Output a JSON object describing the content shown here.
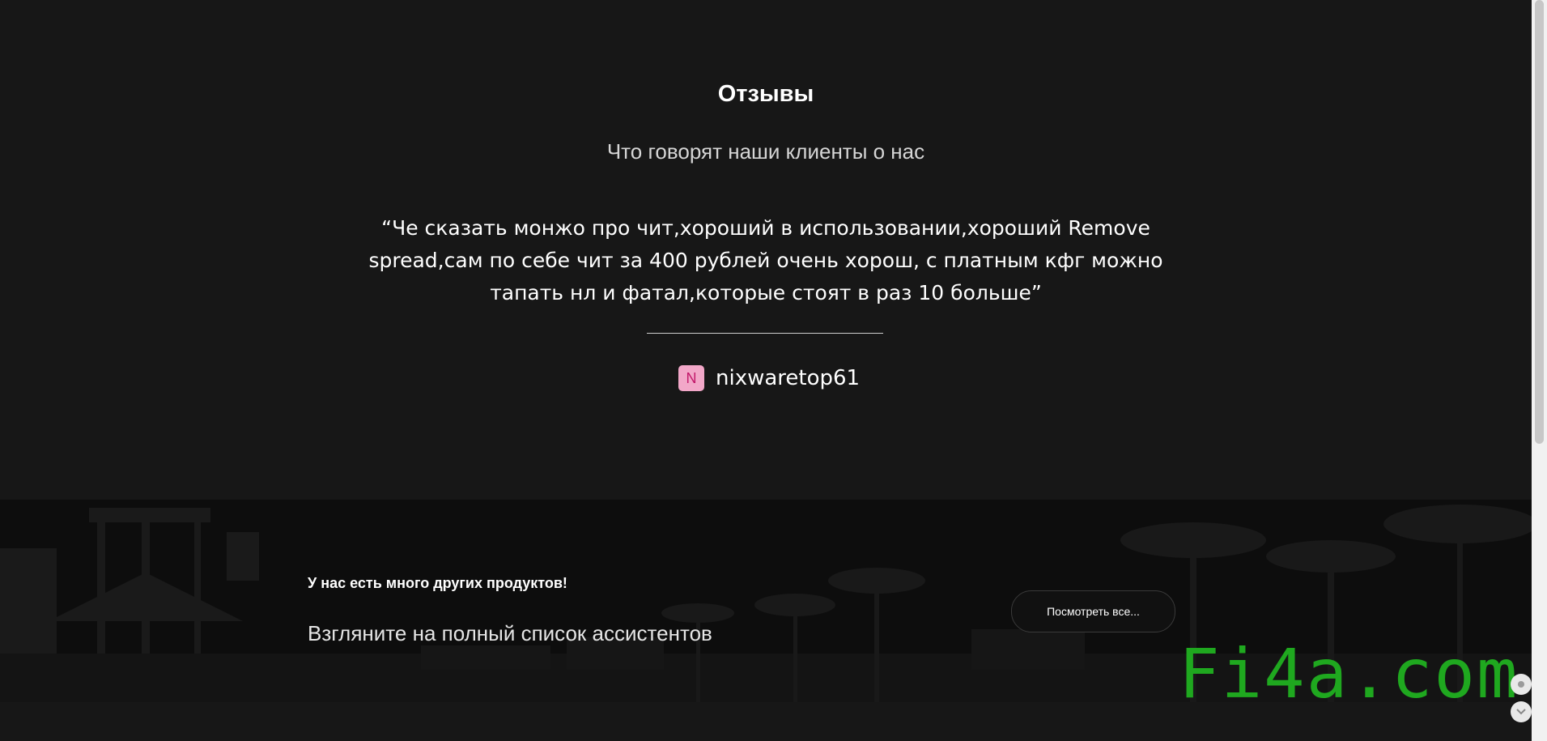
{
  "reviews": {
    "title": "Отзывы",
    "subtitle": "Что говорят наши клиенты о нас",
    "quote": "“Че сказать монжо про чит,хороший в использовании,хороший Remove spread,сам по себе чит за 400 рублей очень хорош, с платным кфг можно тапать нл и фатал,которые стоят в раз 10 больше”",
    "author": {
      "avatar_letter": "N",
      "name": "nixwaretop61",
      "avatar_color": "#f2a7c8"
    }
  },
  "products_banner": {
    "heading": "У нас есть много других продуктов!",
    "text": "Взгляните на полный список ассистентов",
    "button_label": "Посмотреть все..."
  },
  "watermark": {
    "text": "Fi4a.com",
    "color": "#1fa81f"
  },
  "colors": {
    "background": "#171717",
    "banner_background": "#0c0c0c"
  },
  "icons": {
    "float_top": "dot-icon",
    "float_bottom": "chevron-down-icon"
  }
}
